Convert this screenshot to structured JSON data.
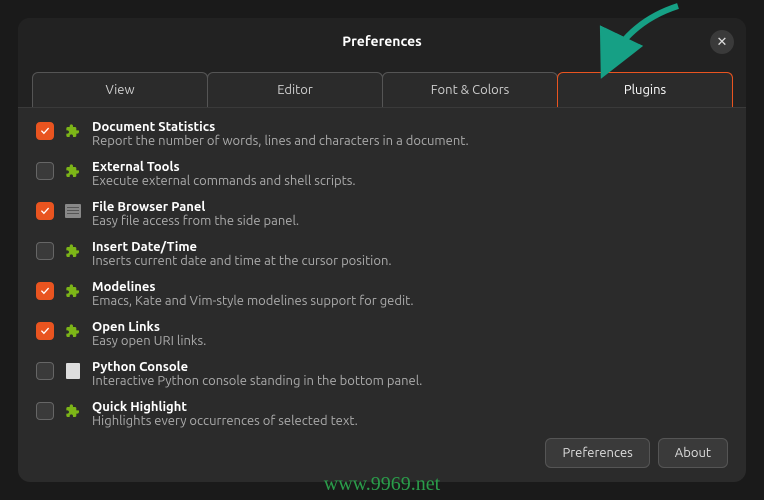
{
  "title": "Preferences",
  "tabs": [
    {
      "label": "View",
      "active": false
    },
    {
      "label": "Editor",
      "active": false
    },
    {
      "label": "Font & Colors",
      "active": false
    },
    {
      "label": "Plugins",
      "active": true
    }
  ],
  "plugins": [
    {
      "title": "Document Statistics",
      "desc": "Report the number of words, lines and characters in a document.",
      "checked": true,
      "icon": "puzzle"
    },
    {
      "title": "External Tools",
      "desc": "Execute external commands and shell scripts.",
      "checked": false,
      "icon": "puzzle"
    },
    {
      "title": "File Browser Panel",
      "desc": "Easy file access from the side panel.",
      "checked": true,
      "icon": "file"
    },
    {
      "title": "Insert Date/Time",
      "desc": "Inserts current date and time at the cursor position.",
      "checked": false,
      "icon": "puzzle"
    },
    {
      "title": "Modelines",
      "desc": "Emacs, Kate and Vim-style modelines support for gedit.",
      "checked": true,
      "icon": "puzzle"
    },
    {
      "title": "Open Links",
      "desc": "Easy open URI links.",
      "checked": true,
      "icon": "puzzle"
    },
    {
      "title": "Python Console",
      "desc": "Interactive Python console standing in the bottom panel.",
      "checked": false,
      "icon": "python"
    },
    {
      "title": "Quick Highlight",
      "desc": "Highlights every occurrences of selected text.",
      "checked": false,
      "icon": "puzzle"
    }
  ],
  "footer": {
    "preferences": "Preferences",
    "about": "About"
  },
  "watermark": "www.9969.net",
  "colors": {
    "accent": "#e95420",
    "arrow": "#16a085"
  }
}
